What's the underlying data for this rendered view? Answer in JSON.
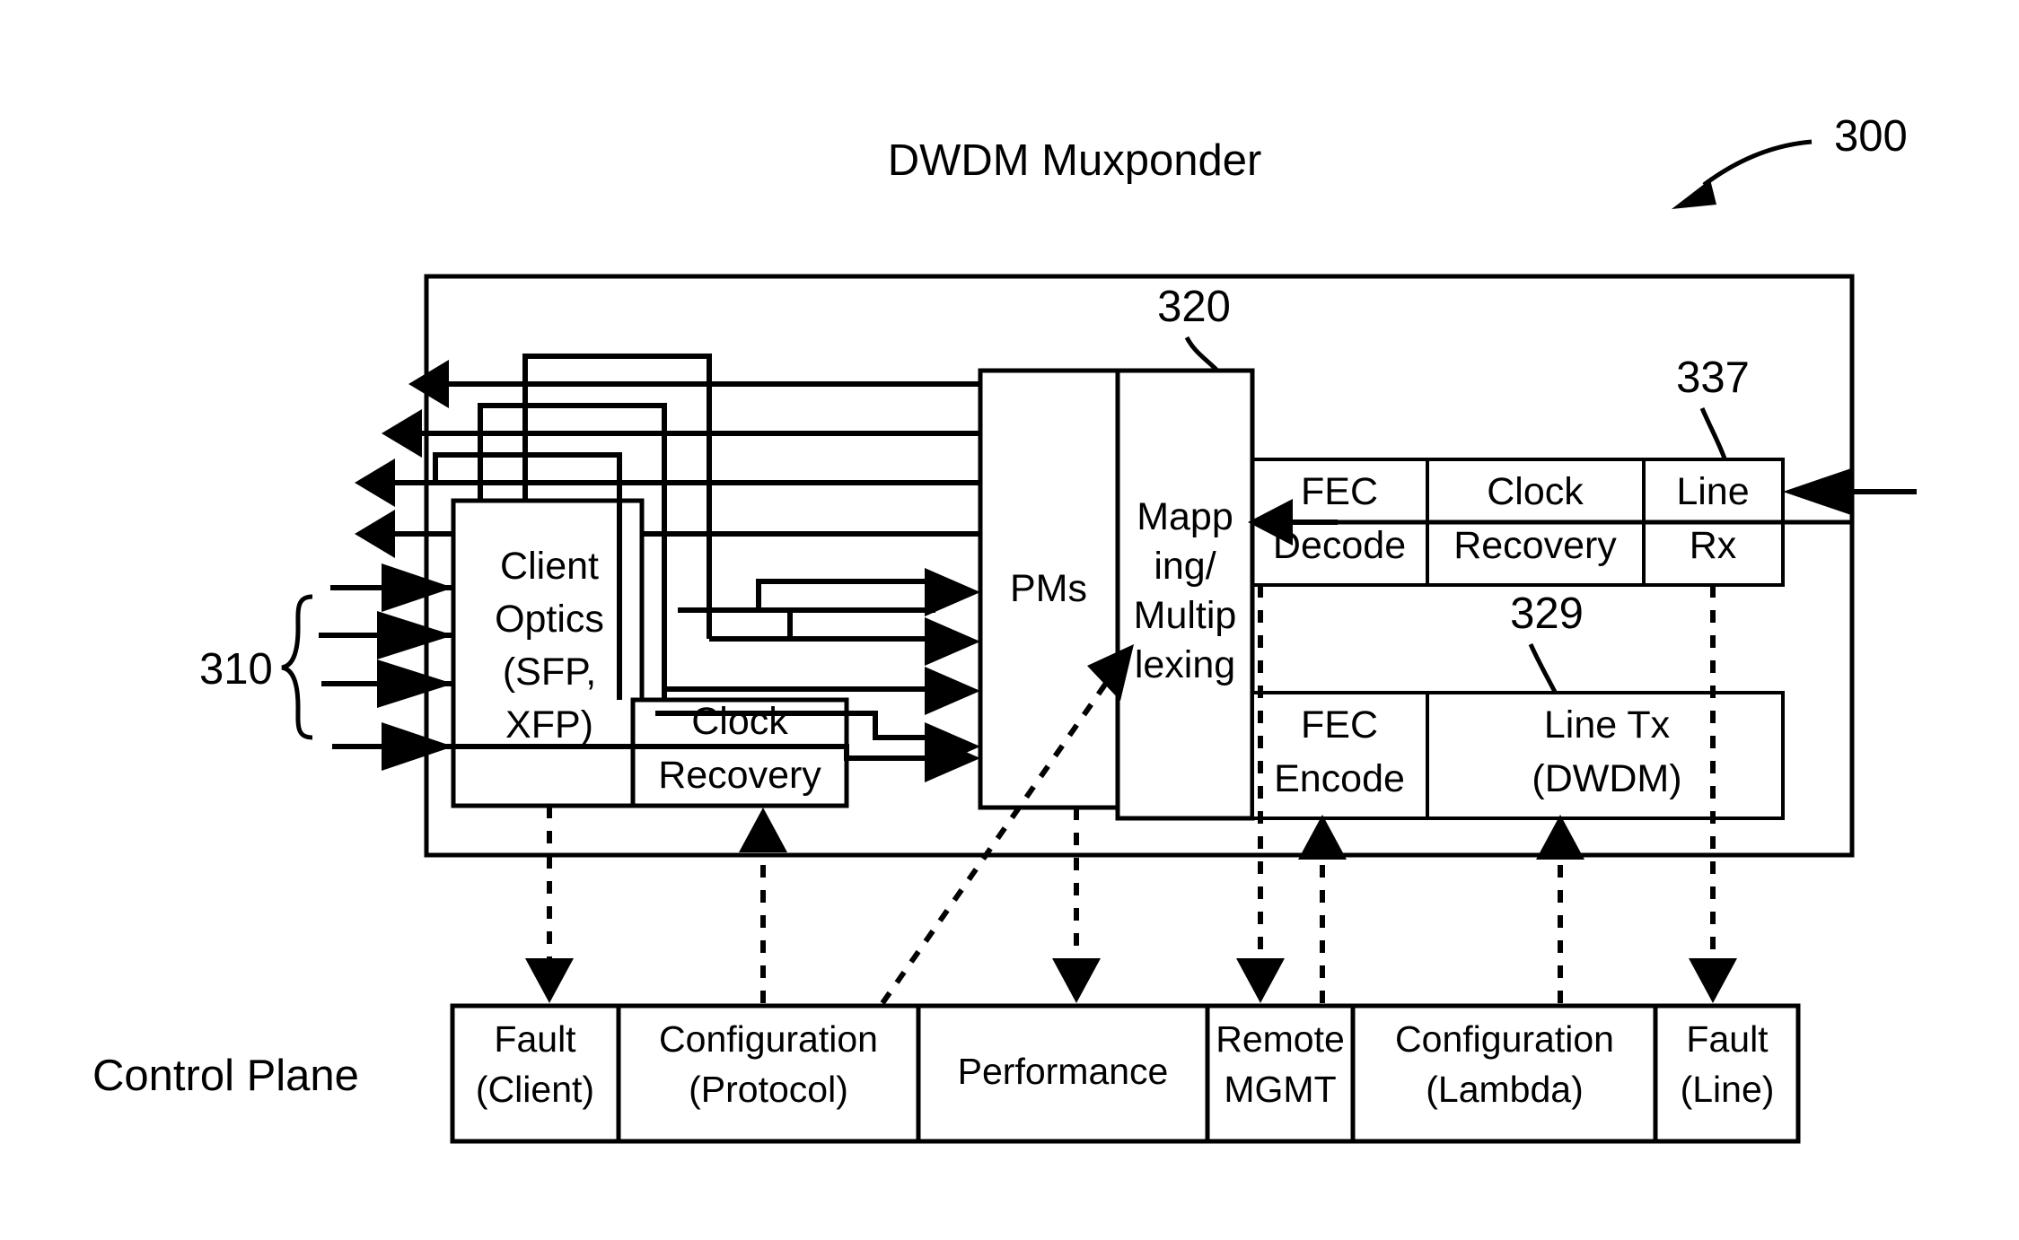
{
  "figure": {
    "title": "DWDM Muxponder",
    "figure_ref": "300",
    "control_plane_label": "Control Plane"
  },
  "reference_numerals": {
    "device": "300",
    "client_group": "310",
    "mapping": "320",
    "line_tx": "329",
    "line_rx": "337"
  },
  "blocks": {
    "client_optics": {
      "line1": "Client",
      "line2": "Optics",
      "line3": "(SFP,",
      "line4": "XFP)"
    },
    "client_clock_recovery": {
      "line1": "Clock",
      "line2": "Recovery"
    },
    "pms": {
      "label": "PMs"
    },
    "mapping": {
      "line1": "Mapp",
      "line2": "ing/",
      "line3": "Multip",
      "line4": "lexing"
    },
    "fec_decode": {
      "line1": "FEC",
      "line2": "Decode"
    },
    "line_clock_recovery": {
      "line1": "Clock",
      "line2": "Recovery"
    },
    "line_rx": {
      "line1": "Line",
      "line2": "Rx"
    },
    "fec_encode": {
      "line1": "FEC",
      "line2": "Encode"
    },
    "line_tx": {
      "line1": "Line Tx",
      "line2": "(DWDM)"
    }
  },
  "control_plane": {
    "label": "Control Plane",
    "items": [
      {
        "line1": "Fault",
        "line2": "(Client)"
      },
      {
        "line1": "Configuration",
        "line2": "(Protocol)"
      },
      {
        "line1": "Performance",
        "line2": ""
      },
      {
        "line1": "Remote",
        "line2": "MGMT"
      },
      {
        "line1": "Configuration",
        "line2": "(Lambda)"
      },
      {
        "line1": "Fault",
        "line2": "(Line)"
      }
    ]
  },
  "colors": {
    "stroke": "#000000",
    "fill": "#ffffff"
  }
}
